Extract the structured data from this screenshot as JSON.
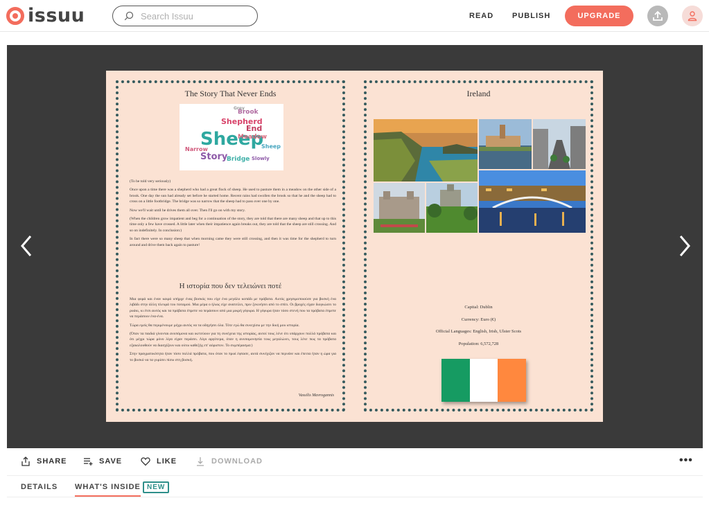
{
  "header": {
    "logo_text": "issuu",
    "search_placeholder": "Search Issuu",
    "nav_read": "READ",
    "nav_publish": "PUBLISH",
    "upgrade_label": "UPGRADE",
    "colors": {
      "accent": "#f36d5d"
    }
  },
  "reader": {
    "left_page": {
      "title": "The Story That Never Ends",
      "wordcloud": [
        "Sheep",
        "Shepherd",
        "Story",
        "End",
        "Meadow",
        "Bridge",
        "Brook",
        "Narrow",
        "Grey",
        "Sheep",
        "Slowly"
      ],
      "paragraphs": [
        "(To be told very seriously)",
        "Once upon a time there was a shepherd who had a great flock of sheep. He used to pasture them in a meadow on the other side of a brook. One day the sun had already set before he started home. Recent rains had swollen the brook so that he and the sheep had to cross on a little footbridge. The bridge was so narrow that the sheep had to pass over one by one.",
        "Now we'll wait until he drives them all over. Then I'll go on with my story.",
        "(When the children grow impatient and beg for a continuation of the story, they are told that there are many sheep and that up to this time only a few have crossed. A little later when their impatience again breaks out, they are told that the sheep are still crossing. And so on indefinitely. In conclusion:)",
        "In fact there were so many sheep that when morning came they were still crossing, and then it was time for the shepherd to turn around and drive them back again to pasture!"
      ],
      "greek_title": "Η ιστορία που δεν τελειώνει ποτέ",
      "greek_paragraphs": [
        "Μια φορά και έναν καιρό υπήρχε ένας βοσκός που είχε ένα μεγάλο κοπάδι με πρόβατα. Αυτός χρησιμοποιούσε για βοσκή ένα λιβάδι στην άλλη πλευρά του ποταμού. Μια μέρα ο ήλιος είχε ανατείλει, πριν ξεκινήσει από το σπίτι. Οι βροχές είχαν διογκώσει το ρυάκι, κι έτσι αυτός και τα πρόβατα έπρεπε να περάσουν από μια μικρή γέφυρα. Η γέφυρα ήταν τόσο στενή που τα πρόβατα έπρεπε να περάσουν ένα-ένα.",
        "Τώρα εμείς θα περιμένουμε μέχρι αυτός να τα οδηγήσει όλα. Τότε εγώ θα συνεχίσω με την δική μου ιστορία.",
        "(Όταν τα παιδιά γίνονται ανυπόμονα και ικετεύουν για τη συνέχεια της ιστορίας, αυτοί τους λένε ότι υπάρχουν πολλά πρόβατα και ότι μέχρι τώρα μόνο λίγα είχαν περάσει. Λίγο αργότερα, όταν η ανυπομονησία τους μεγαλώνει, τους λένε πως τα πρόβατα εξακολουθούν να διασχίζουν και ούτω καθεξής επ' αόριστον. Το συμπέρασμα:)",
        "Στην πραγματικότητα ήταν τόσο πολλά πρόβατα, που όταν το πρωί έφτασε, αυτά συνέχιζαν να περνάνε και έπειτα ήταν η ώρα για το βοσκό να τα γυρίσει πίσω στη βοσκή."
      ],
      "signature": "Vassilis Mavrogannis"
    },
    "right_page": {
      "title": "Ireland",
      "facts": [
        "Capital: Dublin",
        "Currency: Euro (€)",
        "Official Languages: English, Irish, Ulster Scots",
        "Population: 6,572,728"
      ],
      "flag_colors": [
        "#169b62",
        "#ffffff",
        "#ff883e"
      ]
    }
  },
  "actions": {
    "share": "SHARE",
    "save": "SAVE",
    "like": "LIKE",
    "download": "DOWNLOAD",
    "more": "•••"
  },
  "tabs": {
    "details": "DETAILS",
    "whats_inside": "WHAT'S INSIDE",
    "new_badge": "NEW"
  }
}
